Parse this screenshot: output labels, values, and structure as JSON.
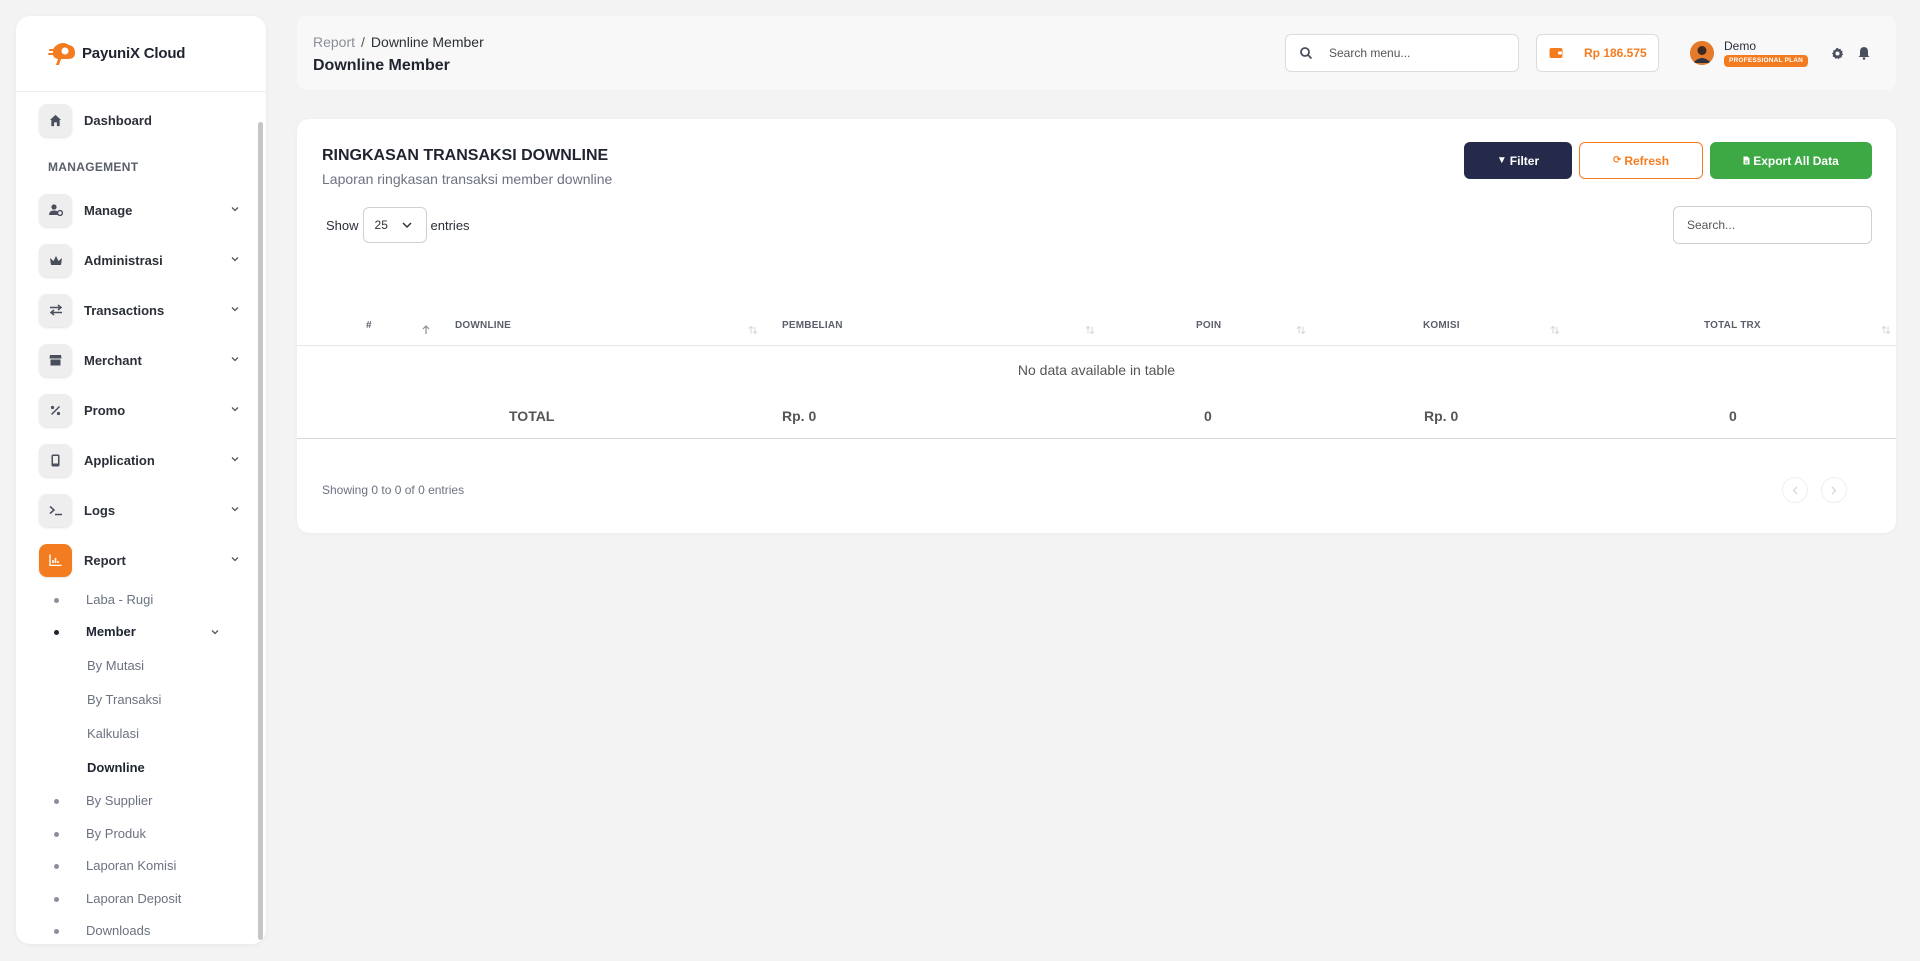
{
  "brand": {
    "name": "PayuniX Cloud"
  },
  "sidebar": {
    "dashboard": "Dashboard",
    "section": "MANAGEMENT",
    "items": [
      {
        "label": "Manage",
        "icon": "user-gear-icon"
      },
      {
        "label": "Administrasi",
        "icon": "crown-icon"
      },
      {
        "label": "Transactions",
        "icon": "arrows-exchange-icon"
      },
      {
        "label": "Merchant",
        "icon": "store-icon"
      },
      {
        "label": "Promo",
        "icon": "percent-icon"
      },
      {
        "label": "Application",
        "icon": "mobile-icon"
      },
      {
        "label": "Logs",
        "icon": "terminal-icon"
      },
      {
        "label": "Report",
        "icon": "chart-bar-icon"
      }
    ],
    "report_sub": {
      "laba_rugi": "Laba - Rugi",
      "member": "Member",
      "member_sub": [
        "By Mutasi",
        "By Transaksi",
        "Kalkulasi",
        "Downline"
      ],
      "by_supplier": "By Supplier",
      "by_produk": "By Produk",
      "laporan_komisi": "Laporan Komisi",
      "laporan_deposit": "Laporan Deposit",
      "downloads": "Downloads"
    }
  },
  "header": {
    "breadcrumb_root": "Report",
    "breadcrumb_sep": "/",
    "breadcrumb_current": "Downline Member",
    "title": "Downline Member",
    "search_placeholder": "Search menu...",
    "balance": "Rp 186.575",
    "user_name": "Demo",
    "plan": "PROFESSIONAL PLAN"
  },
  "card": {
    "title": "RINGKASAN TRANSAKSI DOWNLINE",
    "subtitle": "Laporan ringkasan transaksi member downline",
    "filter_label": "Filter",
    "refresh_label": "Refresh",
    "export_label": "Export All Data",
    "show_label": "Show",
    "entries_value": "25",
    "entries_label": "entries",
    "search_placeholder": "Search..."
  },
  "table": {
    "columns": [
      "#",
      "DOWNLINE",
      "PEMBELIAN",
      "POIN",
      "KOMISI",
      "TOTAL TRX"
    ],
    "empty_message": "No data available in table",
    "footer": {
      "label": "TOTAL",
      "pembelian": "Rp. 0",
      "poin": "0",
      "komisi": "Rp. 0",
      "total_trx": "0"
    },
    "info": "Showing 0 to 0 of 0 entries"
  },
  "colors": {
    "accent": "#f47c20",
    "filter_button": "#262a4a",
    "export_button": "#3da944"
  }
}
